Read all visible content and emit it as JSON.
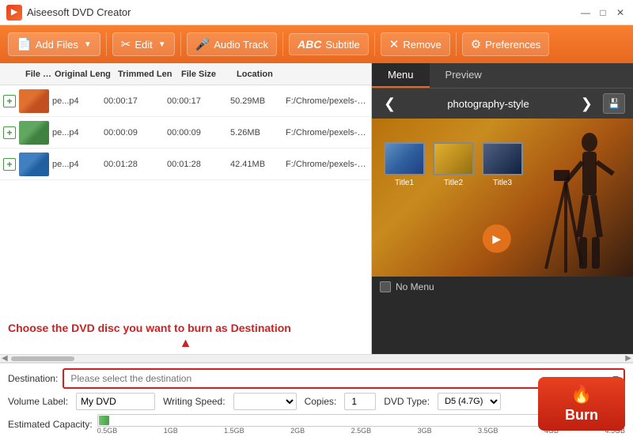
{
  "window": {
    "title": "Aiseesoft DVD Creator",
    "controls": [
      "minimize",
      "maximize",
      "close"
    ]
  },
  "toolbar": {
    "add_files_label": "Add Files",
    "edit_label": "Edit",
    "audio_track_label": "Audio Track",
    "subtitle_label": "Subtitle",
    "remove_label": "Remove",
    "preferences_label": "Preferences"
  },
  "file_list": {
    "headers": {
      "filename": "File Name",
      "orig_length": "Original Leng",
      "trimmed_len": "Trimmed Len",
      "file_size": "File Size",
      "location": "Location"
    },
    "rows": [
      {
        "name": "pe...p4",
        "orig_length": "00:00:17",
        "trimmed_len": "00:00:17",
        "file_size": "50.29MB",
        "location": "F:/Chrome/pexels-gylfi-g..."
      },
      {
        "name": "pe...p4",
        "orig_length": "00:00:09",
        "trimmed_len": "00:00:09",
        "file_size": "5.26MB",
        "location": "F:/Chrome/pexels-zuzann..."
      },
      {
        "name": "pe...p4",
        "orig_length": "00:01:28",
        "trimmed_len": "00:01:28",
        "file_size": "42.41MB",
        "location": "F:/Chrome/pexels-super-l..."
      }
    ]
  },
  "right_panel": {
    "tabs": [
      "Menu",
      "Preview"
    ],
    "active_tab": "Menu",
    "menu_style_name": "photography-style",
    "dvd_thumbnails": [
      {
        "label": "Title1"
      },
      {
        "label": "Title2"
      },
      {
        "label": "Title3"
      }
    ],
    "no_menu_label": "No Menu"
  },
  "annotation": {
    "text": "Choose the DVD disc you want to burn as Destination"
  },
  "bottom_bar": {
    "destination_label": "Destination:",
    "destination_placeholder": "Please select the destination",
    "volume_label": "Volume Label:",
    "volume_value": "My DVD",
    "writing_speed_label": "Writing Speed:",
    "copies_label": "Copies:",
    "copies_value": "1",
    "dvd_type_label": "DVD Type:",
    "dvd_type_value": "D5 (4.7G)",
    "estimated_capacity_label": "Estimated Capacity:",
    "capacity_ticks": [
      "0.5GB",
      "1GB",
      "1.5GB",
      "2GB",
      "2.5GB",
      "3GB",
      "3.5GB",
      "4GB",
      "4.5GB"
    ],
    "burn_label": "Burn"
  }
}
